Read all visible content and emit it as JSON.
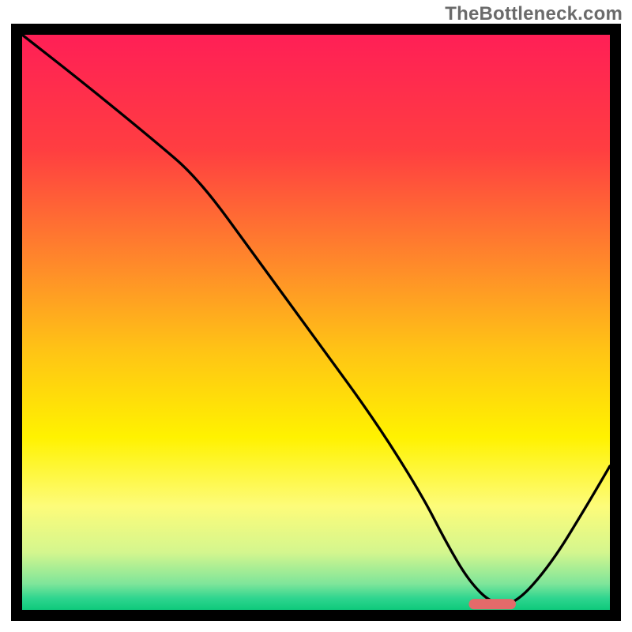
{
  "watermark": "TheBottleneck.com",
  "chart_data": {
    "type": "line",
    "title": "",
    "xlabel": "",
    "ylabel": "",
    "xlim": [
      0,
      100
    ],
    "ylim": [
      0,
      100
    ],
    "grid": false,
    "legend": false,
    "background": {
      "type": "vertical_gradient",
      "stops": [
        {
          "offset": 0.0,
          "color": "#ff1f56"
        },
        {
          "offset": 0.2,
          "color": "#ff3e41"
        },
        {
          "offset": 0.4,
          "color": "#ff8a2a"
        },
        {
          "offset": 0.55,
          "color": "#ffc415"
        },
        {
          "offset": 0.7,
          "color": "#fff200"
        },
        {
          "offset": 0.82,
          "color": "#fdfc7a"
        },
        {
          "offset": 0.9,
          "color": "#d4f68e"
        },
        {
          "offset": 0.955,
          "color": "#7ee59a"
        },
        {
          "offset": 0.98,
          "color": "#2ed58f"
        },
        {
          "offset": 1.0,
          "color": "#0fc97b"
        }
      ]
    },
    "series": [
      {
        "name": "bottleneck-curve",
        "x": [
          0,
          10,
          22,
          30,
          40,
          50,
          60,
          68,
          72,
          76,
          80,
          84,
          90,
          96,
          100
        ],
        "y": [
          100,
          92,
          82,
          75,
          61,
          47,
          33,
          20,
          12,
          5,
          1,
          1,
          8,
          18,
          25
        ]
      }
    ],
    "marker": {
      "name": "optimal-range",
      "x_center": 80,
      "x_halfwidth": 4,
      "y": 1,
      "color": "#e46a6a"
    }
  }
}
